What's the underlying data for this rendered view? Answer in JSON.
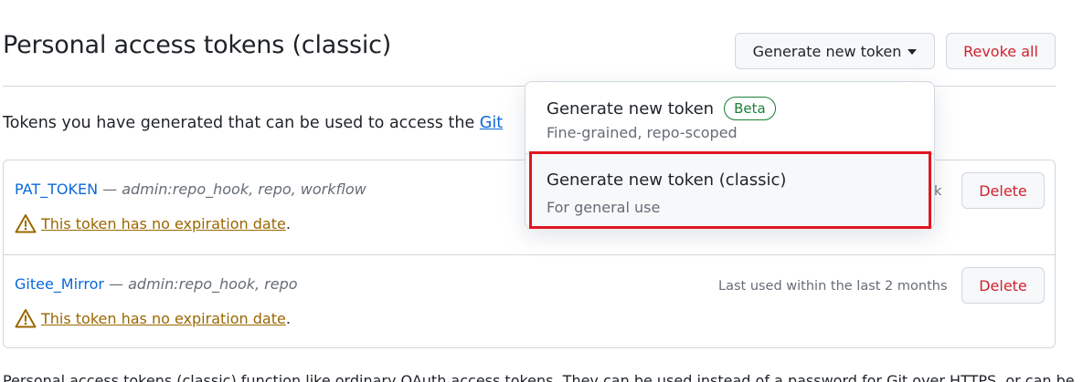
{
  "header": {
    "title": "Personal access tokens (classic)",
    "generate_button": "Generate new token",
    "revoke_button": "Revoke all"
  },
  "intro": {
    "text": "Tokens you have generated that can be used to access the ",
    "link": "Git"
  },
  "tokens": [
    {
      "name": "PAT_TOKEN",
      "separator": " — ",
      "scopes": "admin:repo_hook, repo, workflow",
      "last_used": "k",
      "warning": "This token has no expiration date",
      "warning_end": ".",
      "delete_label": "Delete"
    },
    {
      "name": "Gitee_Mirror",
      "separator": " — ",
      "scopes": "admin:repo_hook, repo",
      "last_used": "Last used within the last 2 months",
      "warning": "This token has no expiration date",
      "warning_end": ".",
      "delete_label": "Delete"
    }
  ],
  "dropdown": {
    "items": [
      {
        "title": "Generate new token",
        "badge": "Beta",
        "subtitle": "Fine-grained, repo-scoped"
      },
      {
        "title": "Generate new token (classic)",
        "subtitle": "For general use"
      }
    ]
  },
  "footer": {
    "text": "Personal access tokens (classic) function like ordinary OAuth access tokens. They can be used instead of a password for Git over HTTPS, or can be"
  },
  "colors": {
    "danger": "#cf222e",
    "link": "#0969da",
    "warning": "#9a6700",
    "success": "#1a7f37",
    "highlight": "#e0161e"
  },
  "icons": {
    "warning": "alert-triangle-icon",
    "caret": "caret-down-icon"
  }
}
